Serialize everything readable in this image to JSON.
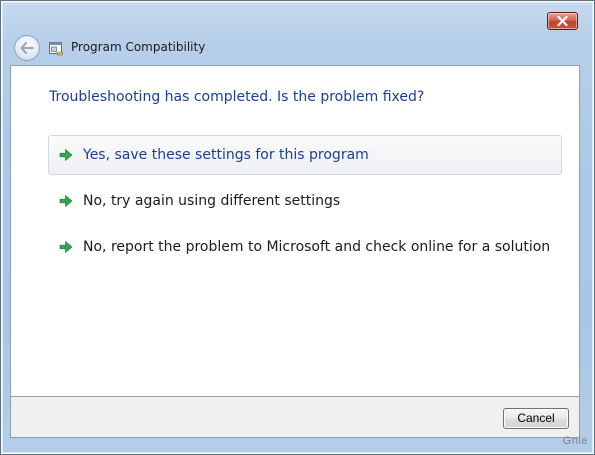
{
  "window": {
    "title": "Program Compatibility",
    "app_icon": "program-compatibility-icon",
    "back_icon": "back-arrow-icon",
    "close_icon": "close-icon"
  },
  "main": {
    "heading": "Troubleshooting has completed.  Is the problem fixed?",
    "options": [
      {
        "label": "Yes, save these settings for this program",
        "icon": "green-arrow-icon",
        "selected": true
      },
      {
        "label": "No, try again using different settings",
        "icon": "green-arrow-icon",
        "selected": false
      },
      {
        "label": "No, report the problem to Microsoft and check online for a solution",
        "icon": "green-arrow-icon",
        "selected": false
      }
    ]
  },
  "footer": {
    "cancel_label": "Cancel"
  },
  "watermark": "Gnie",
  "colors": {
    "heading": "#1a3e96",
    "arrow": "#2fa84f",
    "close": "#c1402a"
  }
}
